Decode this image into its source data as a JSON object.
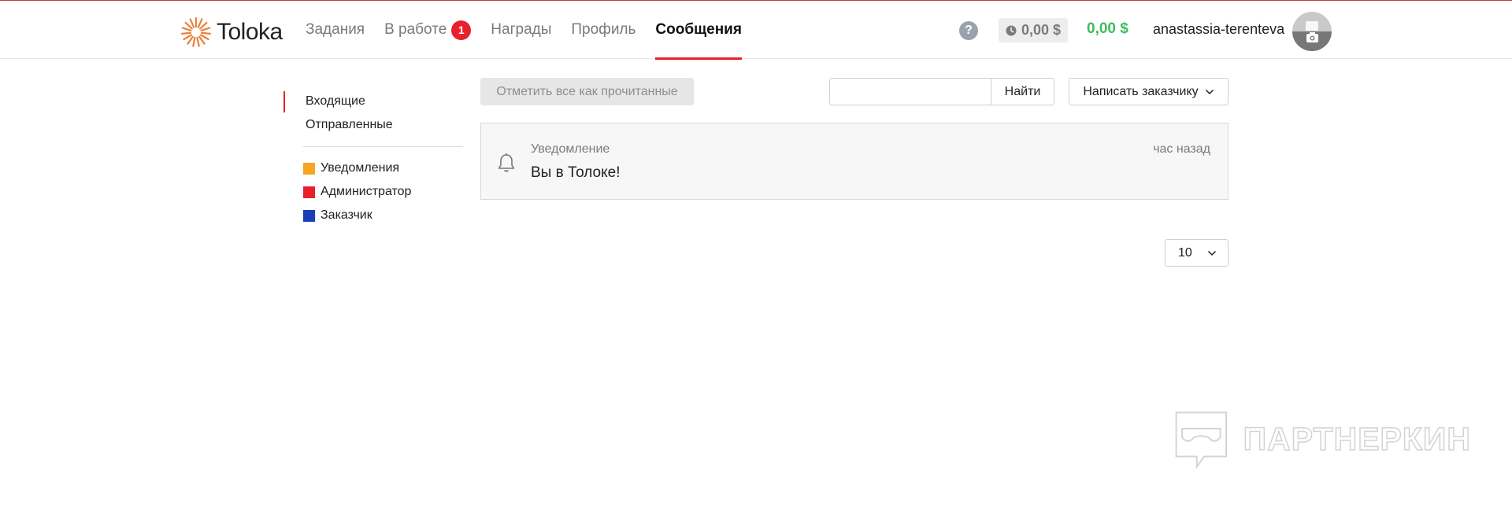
{
  "app": {
    "logo_text": "Toloka"
  },
  "nav": {
    "items": [
      {
        "label": "Задания"
      },
      {
        "label": "В работе",
        "badge": "1"
      },
      {
        "label": "Награды"
      },
      {
        "label": "Профиль"
      },
      {
        "label": "Сообщения",
        "active": true
      }
    ]
  },
  "header": {
    "help": "?",
    "pending_balance": "0,00 $",
    "balance": "0,00 $",
    "username": "anastassia-terenteva"
  },
  "sidebar": {
    "folders": [
      {
        "label": "Входящие",
        "active": true
      },
      {
        "label": "Отправленные"
      }
    ],
    "categories": [
      {
        "label": "Уведомления",
        "color": "#f5a623"
      },
      {
        "label": "Администратор",
        "color": "#e8202b"
      },
      {
        "label": "Заказчик",
        "color": "#1a3fb5"
      }
    ]
  },
  "toolbar": {
    "mark_all_read": "Отметить все как прочитанные",
    "search_value": "",
    "search_button": "Найти",
    "write_button": "Написать заказчику"
  },
  "messages": [
    {
      "type": "Уведомление",
      "title": "Вы в Толоке!",
      "time": "час назад",
      "icon": "bell-icon"
    }
  ],
  "pagination": {
    "per_page": "10"
  },
  "watermark": {
    "text": "ПАРТНЕРКИН"
  },
  "colors": {
    "accent": "#e8202b",
    "balance": "#3fbc5e"
  }
}
